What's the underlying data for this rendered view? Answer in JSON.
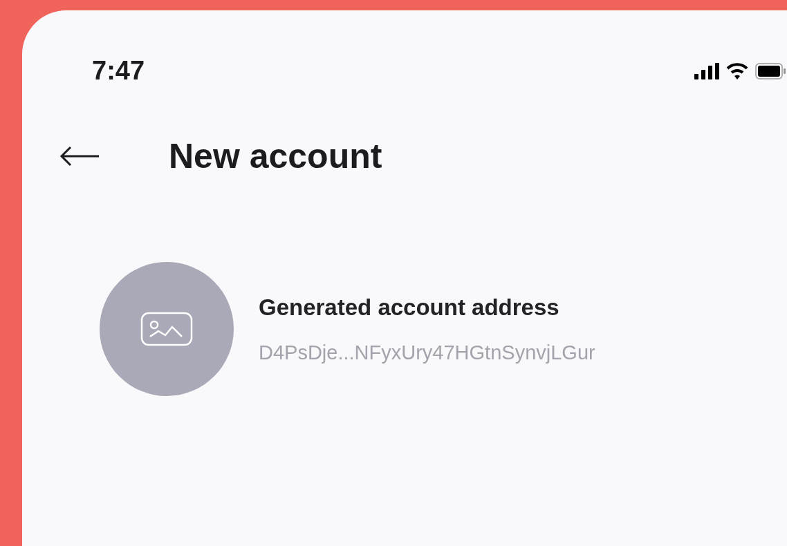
{
  "status_bar": {
    "time": "7:47"
  },
  "header": {
    "title": "New account"
  },
  "account": {
    "label": "Generated account address",
    "address": "D4PsDje...NFyxUry47HGtnSynvjLGur"
  }
}
